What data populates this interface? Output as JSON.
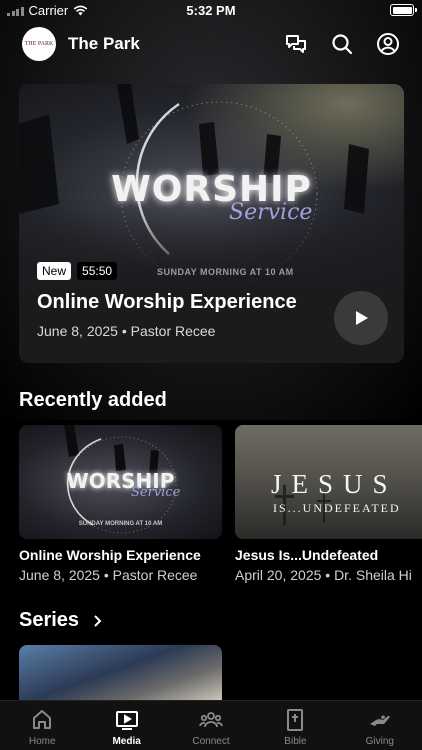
{
  "status": {
    "carrier": "Carrier",
    "time": "5:32 PM"
  },
  "header": {
    "logo_text": "THE PARK",
    "title": "The Park"
  },
  "hero": {
    "art_word": "WORSHIP",
    "art_script": "Service",
    "art_subtitle": "SUNDAY MORNING AT 10 AM",
    "badge_new": "New",
    "duration": "55:50",
    "title": "Online Worship Experience",
    "meta": "June 8, 2025 • Pastor Recee"
  },
  "recent": {
    "heading": "Recently added",
    "items": [
      {
        "art_word": "WORSHIP",
        "art_script": "Service",
        "art_subtitle": "SUNDAY MORNING AT 10 AM",
        "title": "Online Worship Experience",
        "meta": "June 8, 2025 • Pastor Recee"
      },
      {
        "art_word": "JESUS",
        "art_script": "IS...UNDEFEATED",
        "title": "Jesus Is...Undefeated",
        "meta": "April 20, 2025 • Dr. Sheila Hi"
      }
    ]
  },
  "series": {
    "heading": "Series"
  },
  "tabs": [
    {
      "label": "Home",
      "icon": "home-icon"
    },
    {
      "label": "Media",
      "icon": "media-icon"
    },
    {
      "label": "Connect",
      "icon": "connect-icon"
    },
    {
      "label": "Bible",
      "icon": "bible-icon"
    },
    {
      "label": "Giving",
      "icon": "giving-icon"
    }
  ],
  "active_tab": "Media"
}
